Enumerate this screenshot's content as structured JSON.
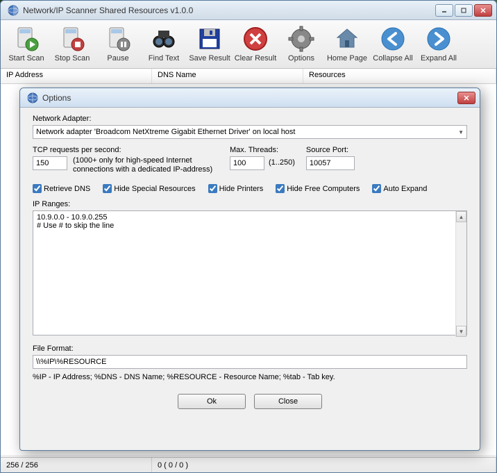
{
  "main": {
    "title": "Network/IP Scanner Shared Resources v1.0.0",
    "toolbar": [
      {
        "label": "Start Scan",
        "icon": "scanner-play"
      },
      {
        "label": "Stop Scan",
        "icon": "scanner-stop"
      },
      {
        "label": "Pause",
        "icon": "scanner-pause"
      },
      {
        "label": "Find Text",
        "icon": "binoculars"
      },
      {
        "label": "Save Result",
        "icon": "floppy"
      },
      {
        "label": "Clear Result",
        "icon": "error-x"
      },
      {
        "label": "Options",
        "icon": "gear"
      },
      {
        "label": "Home Page",
        "icon": "home"
      },
      {
        "label": "Collapse All",
        "icon": "arrow-left"
      },
      {
        "label": "Expand All",
        "icon": "arrow-right"
      }
    ],
    "columns": {
      "ip": "IP Address",
      "dns": "DNS Name",
      "res": "Resources"
    },
    "status": {
      "left": "256 / 256",
      "right": "0 ( 0 / 0 )"
    }
  },
  "dialog": {
    "title": "Options",
    "adapter_label": "Network Adapter:",
    "adapter_value": "Network adapter 'Broadcom NetXtreme Gigabit Ethernet Driver' on local host",
    "tcp_label": "TCP requests per second:",
    "tcp_value": "150",
    "tcp_hint": "(1000+ only for high-speed Internet\nconnections with a dedicated IP-address)",
    "max_threads_label": "Max. Threads:",
    "max_threads_value": "100",
    "max_threads_hint": "(1..250)",
    "source_port_label": "Source Port:",
    "source_port_value": "10057",
    "checks": {
      "retrieve_dns": "Retrieve DNS",
      "hide_special": "Hide Special Resources",
      "hide_printers": "Hide Printers",
      "hide_free": "Hide Free Computers",
      "auto_expand": "Auto Expand"
    },
    "ip_ranges_label": "IP Ranges:",
    "ip_ranges_value": "10.9.0.0 - 10.9.0.255\n# Use # to skip the line",
    "file_format_label": "File Format:",
    "file_format_value": "\\\\%IP\\%RESOURCE",
    "legend": "%IP - IP Address; %DNS - DNS Name; %RESOURCE - Resource Name; %tab - Tab key.",
    "ok": "Ok",
    "close": "Close"
  }
}
